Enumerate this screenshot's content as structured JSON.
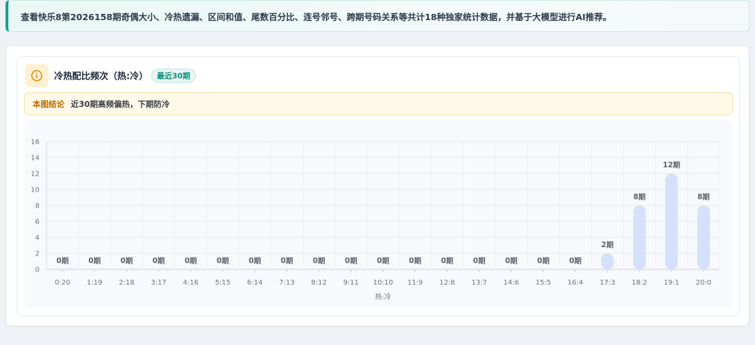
{
  "banner": {
    "text": "查看快乐8第2026158期奇偶大小、冷热遗漏、区间和值、尾数百分比、连号邻号、跨期号码关系等共计18种独家统计数据，并基于大模型进行AI推荐。"
  },
  "card": {
    "icon": "info-icon",
    "title": "冷热配比频次（热:冷）",
    "badge": "最近30期",
    "conclusion_label": "本图结论",
    "conclusion_text": "近30期高频偏热，下期防冷"
  },
  "colors": {
    "accent": "#14a08f",
    "bar": "#d5e0fa",
    "warning": "#b86a00"
  },
  "chart_data": {
    "type": "bar",
    "categories": [
      "0:20",
      "1:19",
      "2:18",
      "3:17",
      "4:16",
      "5:15",
      "6:14",
      "7:13",
      "8:12",
      "9:11",
      "10:10",
      "11:9",
      "12:8",
      "13:7",
      "14:6",
      "15:5",
      "16:4",
      "17:3",
      "18:2",
      "19:1",
      "20:0"
    ],
    "values": [
      0,
      0,
      0,
      0,
      0,
      0,
      0,
      0,
      0,
      0,
      0,
      0,
      0,
      0,
      0,
      0,
      0,
      2,
      8,
      12,
      8
    ],
    "data_labels": [
      "0期",
      "0期",
      "0期",
      "0期",
      "0期",
      "0期",
      "0期",
      "0期",
      "0期",
      "0期",
      "0期",
      "0期",
      "0期",
      "0期",
      "0期",
      "0期",
      "0期",
      "2期",
      "8期",
      "12期",
      "8期"
    ],
    "xlabel": "热:冷",
    "ylabel": "",
    "ylim": [
      0,
      16
    ],
    "yticks": [
      "0",
      "2",
      "4",
      "6",
      "8",
      "10",
      "12",
      "14",
      "16"
    ],
    "grid": true
  }
}
